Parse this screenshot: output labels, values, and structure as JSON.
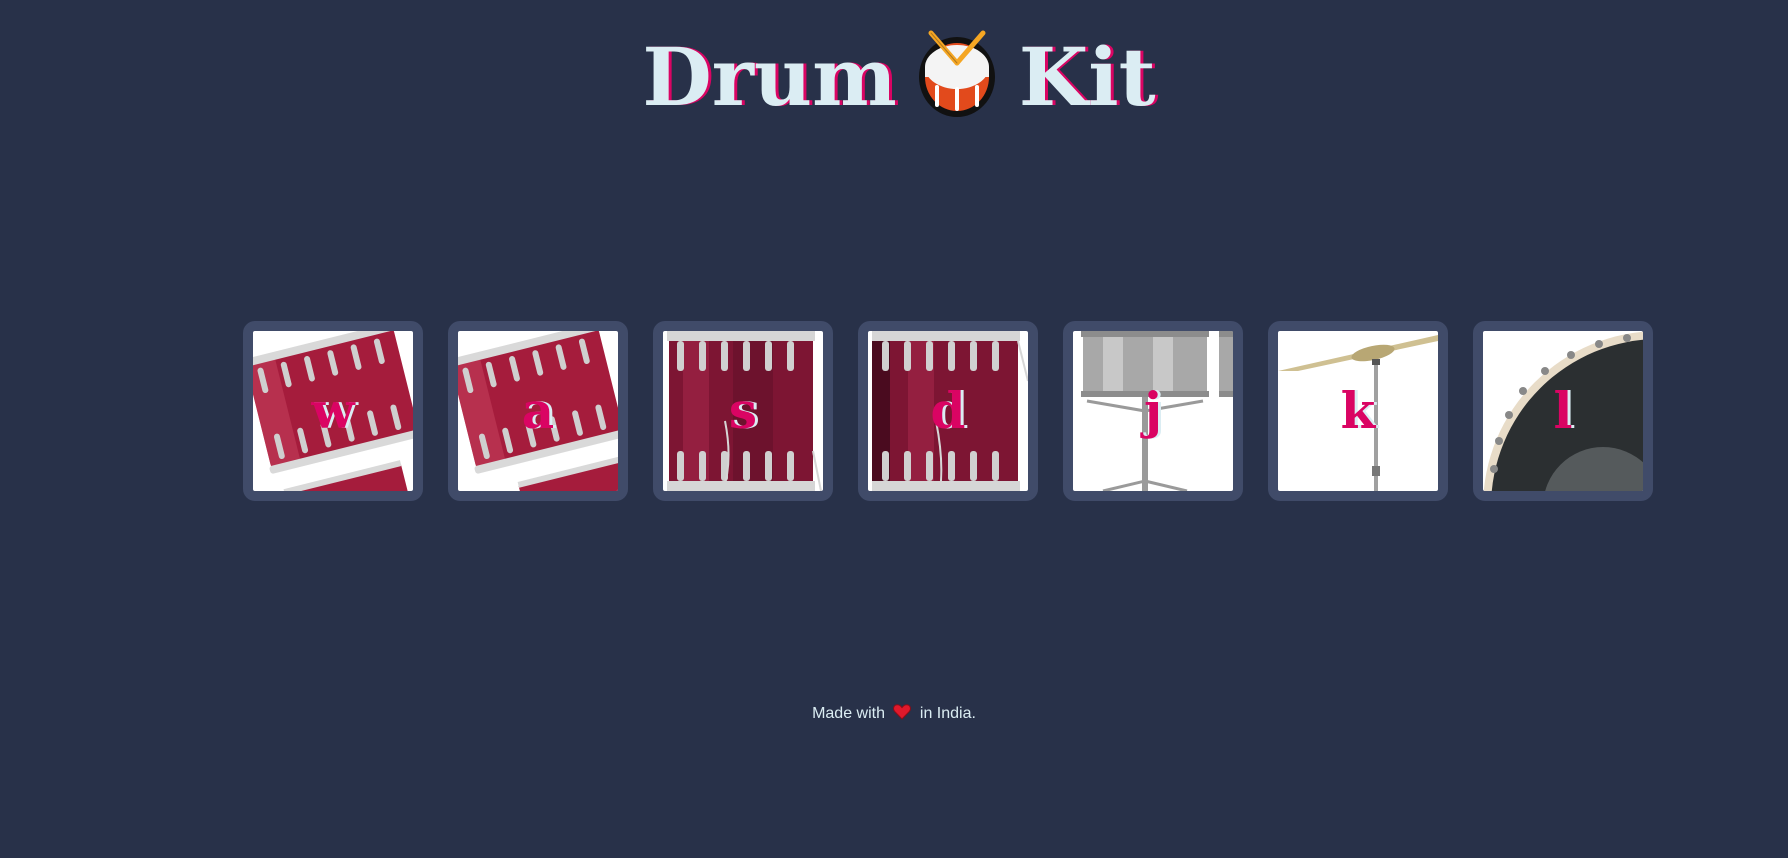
{
  "header": {
    "title_part1": "Drum",
    "title_icon": "drum-icon",
    "title_part2": "Kit"
  },
  "drums": [
    {
      "key": "w",
      "sound": "tom-1",
      "icon": "tom-drum-image"
    },
    {
      "key": "a",
      "sound": "tom-2",
      "icon": "tom-drum-image"
    },
    {
      "key": "s",
      "sound": "tom-3",
      "icon": "floor-tom-image"
    },
    {
      "key": "d",
      "sound": "tom-4",
      "icon": "floor-tom-image"
    },
    {
      "key": "j",
      "sound": "snare",
      "icon": "snare-drum-image"
    },
    {
      "key": "k",
      "sound": "crash",
      "icon": "crash-cymbal-image"
    },
    {
      "key": "l",
      "sound": "kick-bass",
      "icon": "kick-drum-image"
    }
  ],
  "footer": {
    "before": "Made with",
    "icon": "heart-icon",
    "after": "in India."
  },
  "colors": {
    "background": "#283149",
    "tile_border": "#404b69",
    "title_text": "#dbedf3",
    "accent": "#da0463"
  }
}
